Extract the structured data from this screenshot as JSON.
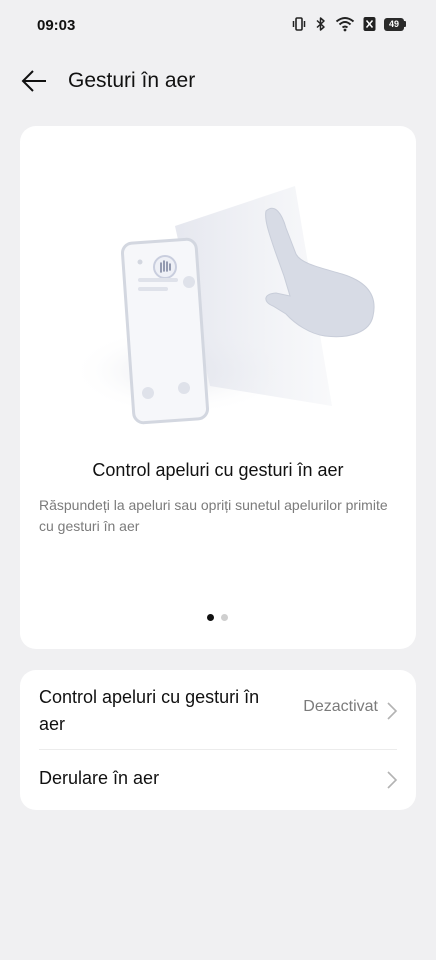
{
  "status_bar": {
    "time": "09:03",
    "battery_level": "49",
    "icons": [
      "vibrate-icon",
      "bluetooth-icon",
      "wifi-icon",
      "no-sim-icon",
      "battery-icon"
    ]
  },
  "header": {
    "title": "Gesturi în aer",
    "back_icon": "back-arrow-icon"
  },
  "hero": {
    "title": "Control apeluri cu gesturi în aer",
    "description": "Răspundeți la apeluri sau opriți sunetul apelurilor primite cu gesturi în aer",
    "pager": {
      "total": 2,
      "active": 1
    }
  },
  "settings": [
    {
      "label": "Control apeluri cu gesturi în aer",
      "value": "Dezactivat"
    },
    {
      "label": "Derulare în aer",
      "value": ""
    }
  ],
  "colors": {
    "background": "#f0f0f2",
    "card": "#ffffff",
    "secondary_text": "#7b7b7b",
    "illustration": "#dfe2ea"
  }
}
